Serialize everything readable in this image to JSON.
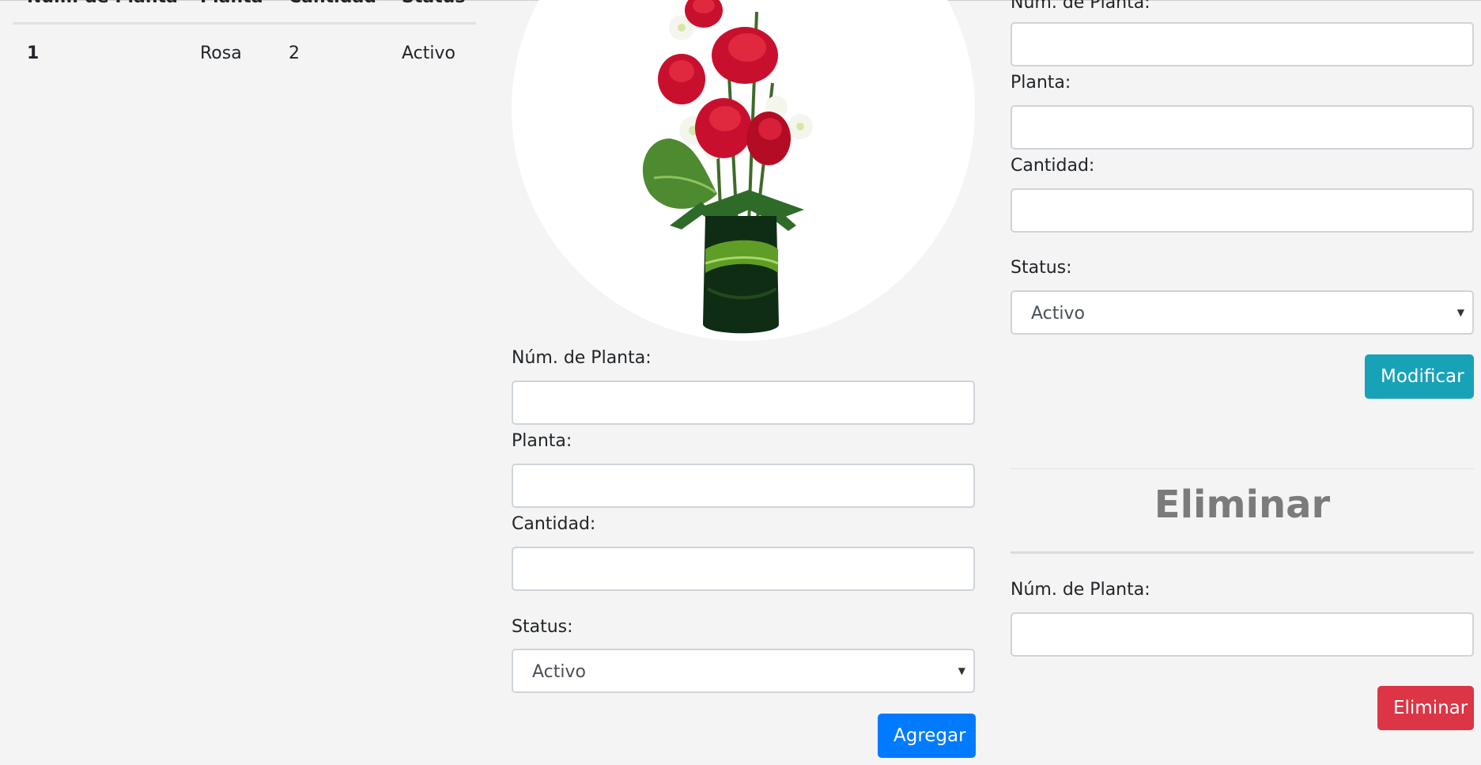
{
  "table": {
    "headers": [
      "Núm. de Planta",
      "Planta",
      "Cantidad",
      "Status"
    ],
    "rows": [
      {
        "num": "1",
        "planta": "Rosa",
        "cantidad": "2",
        "status": "Activo"
      }
    ]
  },
  "add_form": {
    "num_label": "Núm. de Planta:",
    "planta_label": "Planta:",
    "cantidad_label": "Cantidad:",
    "status_label": "Status:",
    "status_value": "Activo",
    "submit_label": "Agregar"
  },
  "modify_form": {
    "num_label": "Núm. de Planta:",
    "planta_label": "Planta:",
    "cantidad_label": "Cantidad:",
    "status_label": "Status:",
    "status_value": "Activo",
    "submit_label": "Modificar"
  },
  "delete_form": {
    "title": "Eliminar",
    "num_label": "Núm. de Planta:",
    "submit_label": "Eliminar"
  },
  "colors": {
    "primary": "#007bff",
    "info": "#17a2b8",
    "danger": "#dc3545",
    "background": "#f4f4f4"
  },
  "icons": {
    "select_caret": "caret-down-icon"
  }
}
